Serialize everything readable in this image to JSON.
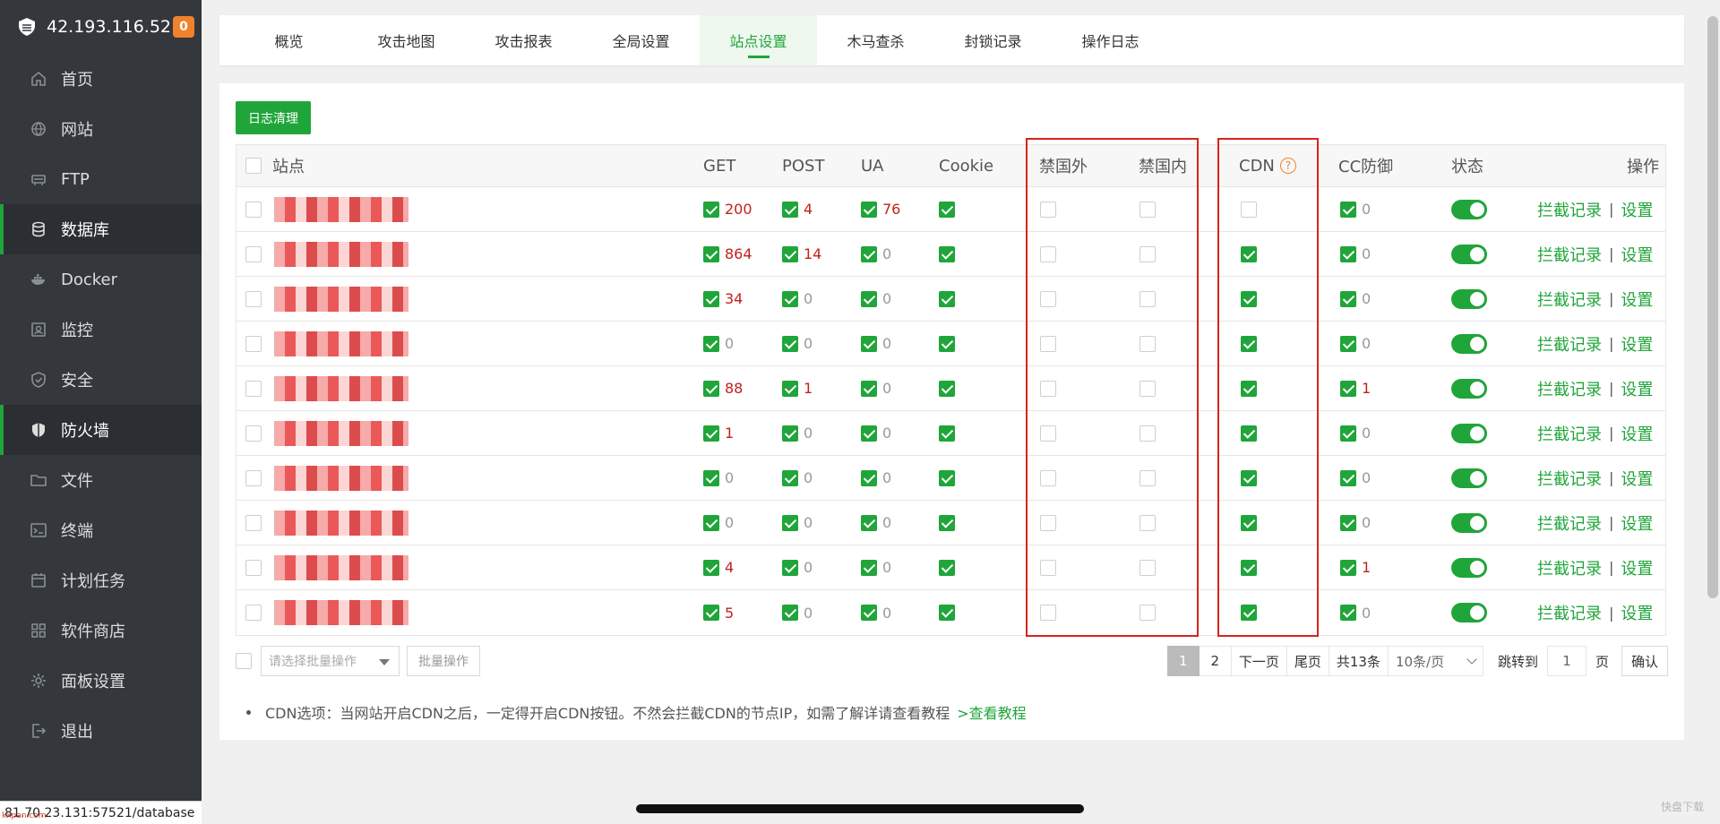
{
  "sidebar": {
    "host": "42.193.116.52",
    "badge": "0",
    "items": [
      {
        "label": "首页",
        "icon": "home-icon"
      },
      {
        "label": "网站",
        "icon": "globe-icon"
      },
      {
        "label": "FTP",
        "icon": "ftp-icon"
      },
      {
        "label": "数据库",
        "icon": "database-icon",
        "active": true
      },
      {
        "label": "Docker",
        "icon": "docker-icon"
      },
      {
        "label": "监控",
        "icon": "monitor-icon"
      },
      {
        "label": "安全",
        "icon": "shield-icon"
      },
      {
        "label": "防火墙",
        "icon": "firewall-icon",
        "active": true
      },
      {
        "label": "文件",
        "icon": "folder-icon"
      },
      {
        "label": "终端",
        "icon": "terminal-icon"
      },
      {
        "label": "计划任务",
        "icon": "calendar-icon"
      },
      {
        "label": "软件商店",
        "icon": "grid-icon"
      },
      {
        "label": "面板设置",
        "icon": "gear-icon"
      },
      {
        "label": "退出",
        "icon": "logout-icon"
      }
    ],
    "status_url": "81.70.23.131:57521/database",
    "watermark": "kxpan.com"
  },
  "tabs": [
    {
      "label": "概览"
    },
    {
      "label": "攻击地图"
    },
    {
      "label": "攻击报表"
    },
    {
      "label": "全局设置"
    },
    {
      "label": "站点设置",
      "active": true
    },
    {
      "label": "木马查杀"
    },
    {
      "label": "封锁记录"
    },
    {
      "label": "操作日志"
    }
  ],
  "log_clean_label": "日志清理",
  "table": {
    "headers": {
      "site": "站点",
      "get": "GET",
      "post": "POST",
      "ua": "UA",
      "cookie": "Cookie",
      "ban_foreign": "禁国外",
      "ban_domestic": "禁国内",
      "cdn": "CDN",
      "cc": "CC防御",
      "status": "状态",
      "action": "操作"
    },
    "action_block": "拦截记录",
    "action_sep": "|",
    "action_settings": "设置",
    "rows": [
      {
        "get": "200",
        "post": "4",
        "ua": "76",
        "cdn": false,
        "cc": "0"
      },
      {
        "get": "864",
        "post": "14",
        "ua": "0",
        "cdn": true,
        "cc": "0"
      },
      {
        "get": "34",
        "post": "0",
        "ua": "0",
        "cdn": true,
        "cc": "0"
      },
      {
        "get": "0",
        "post": "0",
        "ua": "0",
        "cdn": true,
        "cc": "0"
      },
      {
        "get": "88",
        "post": "1",
        "ua": "0",
        "cdn": true,
        "cc": "1"
      },
      {
        "get": "1",
        "post": "0",
        "ua": "0",
        "cdn": true,
        "cc": "0"
      },
      {
        "get": "0",
        "post": "0",
        "ua": "0",
        "cdn": true,
        "cc": "0"
      },
      {
        "get": "0",
        "post": "0",
        "ua": "0",
        "cdn": true,
        "cc": "0"
      },
      {
        "get": "4",
        "post": "0",
        "ua": "0",
        "cdn": true,
        "cc": "1"
      },
      {
        "get": "5",
        "post": "0",
        "ua": "0",
        "cdn": true,
        "cc": "0"
      }
    ]
  },
  "bulk": {
    "placeholder": "请选择批量操作",
    "button": "批量操作"
  },
  "pager": {
    "pages": [
      "1",
      "2"
    ],
    "next": "下一页",
    "last": "尾页",
    "total": "共13条",
    "per_page": "10条/页",
    "jump_label": "跳转到",
    "jump_value": "1",
    "page_unit": "页",
    "confirm": "确认"
  },
  "note": {
    "text": "CDN选项：当网站开启CDN之后，一定得开启CDN按钮。不然会拦截CDN的节点IP，如需了解详请查看教程",
    "link": ">查看教程"
  },
  "corner_mark": "快盘下载",
  "colors": {
    "accent": "#20a53a",
    "highlight": "#d9231b",
    "count_red": "#c0221b"
  }
}
